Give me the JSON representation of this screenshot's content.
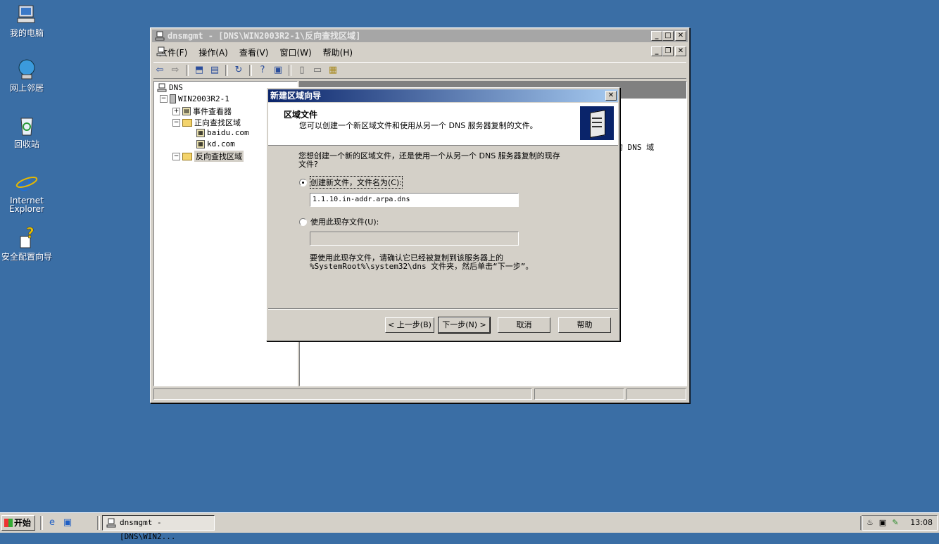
{
  "desktop": {
    "icons": [
      {
        "label": "我的电脑",
        "icon": "my-computer-icon"
      },
      {
        "label": "网上邻居",
        "icon": "network-places-icon"
      },
      {
        "label": "回收站",
        "icon": "recycle-bin-icon"
      },
      {
        "label": "Internet Explorer",
        "icon": "internet-explorer-icon"
      },
      {
        "label": "安全配置向导",
        "icon": "security-config-wizard-icon"
      }
    ]
  },
  "window": {
    "title": "dnsmgmt - [DNS\\WIN2003R2-1\\反向查找区域]",
    "menu": [
      "文件(F)",
      "操作(A)",
      "查看(V)",
      "窗口(W)",
      "帮助(H)"
    ],
    "tree": {
      "root": "DNS",
      "server": "WIN2003R2-1",
      "items": [
        "事件查看器",
        "正向查找区域",
        "baidu.com",
        "kd.com",
        "反向查找区域"
      ]
    },
    "right_snippet": "的 DNS 域"
  },
  "dialog": {
    "title": "新建区域向导",
    "header_title": "区域文件",
    "header_subtitle": "您可以创建一个新区域文件和使用从另一个 DNS 服务器复制的文件。",
    "question_line1": "您想创建一个新的区域文件，还是使用一个从另一个 DNS 服务器复制的现存",
    "question_line2": "文件?",
    "option_create": "创建新文件，文件名为(C):",
    "option_create_selected": true,
    "filename_value": "1.1.10.in-addr.arpa.dns",
    "option_existing": "使用此现存文件(U):",
    "existing_value": "",
    "note_line1": "要使用此现存文件，请确认它已经被复制到该服务器上的",
    "note_line2": "%SystemRoot%\\system32\\dns 文件夹，然后单击“下一步”。",
    "buttons": {
      "back": "< 上一步(B)",
      "next": "下一步(N) >",
      "cancel": "取消",
      "help": "帮助"
    }
  },
  "taskbar": {
    "start": "开始",
    "task": "dnsmgmt - [DNS\\WIN2...",
    "clock": "13:08"
  }
}
